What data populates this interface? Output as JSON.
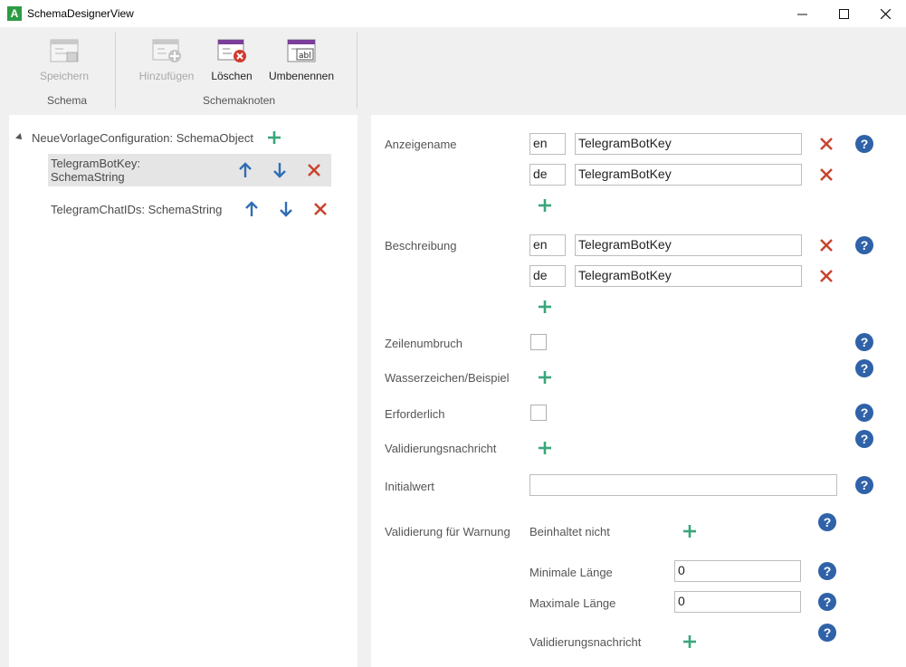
{
  "window": {
    "title": "SchemaDesignerView",
    "app_icon_letter": "A",
    "controls": [
      "minimize-icon",
      "maximize-icon",
      "close-icon"
    ]
  },
  "ribbon": {
    "groups": [
      {
        "label": "Schema",
        "buttons": [
          {
            "label": "Speichern",
            "enabled": false,
            "icon": "save-schema-icon"
          }
        ]
      },
      {
        "label": "Schemaknoten",
        "buttons": [
          {
            "label": "Hinzufügen",
            "enabled": false,
            "icon": "add-node-icon"
          },
          {
            "label": "Löschen",
            "enabled": true,
            "icon": "delete-node-icon"
          },
          {
            "label": "Umbenennen",
            "enabled": true,
            "icon": "rename-node-icon"
          }
        ]
      }
    ]
  },
  "tree": {
    "root": {
      "label": "NeueVorlageConfiguration: SchemaObject"
    },
    "items": [
      {
        "label": "TelegramBotKey: SchemaString",
        "selected": true
      },
      {
        "label": "TelegramChatIDs: SchemaString",
        "selected": false
      }
    ]
  },
  "properties": {
    "anzeigename": {
      "label": "Anzeigename",
      "entries": [
        {
          "lang": "en",
          "value": "TelegramBotKey"
        },
        {
          "lang": "de",
          "value": "TelegramBotKey"
        }
      ]
    },
    "beschreibung": {
      "label": "Beschreibung",
      "entries": [
        {
          "lang": "en",
          "value": "TelegramBotKey"
        },
        {
          "lang": "de",
          "value": "TelegramBotKey"
        }
      ]
    },
    "zeilenumbruch": {
      "label": "Zeilenumbruch",
      "checked": false
    },
    "wasserzeichen": {
      "label": "Wasserzeichen/Beispiel"
    },
    "erforderlich": {
      "label": "Erforderlich",
      "checked": false
    },
    "validierungsnachricht": {
      "label": "Validierungsnachricht"
    },
    "initialwert": {
      "label": "Initialwert",
      "value": ""
    },
    "warnung": {
      "label": "Validierung für Warnung",
      "beinhaltet_nicht": "Beinhaltet nicht",
      "min_label": "Minimale Länge",
      "min_value": "0",
      "max_label": "Maximale Länge",
      "max_value": "0",
      "nachricht_label": "Validierungsnachricht"
    }
  },
  "colors": {
    "add_green": "#3aa67a",
    "delete_red": "#c8452f",
    "arrow_blue": "#2f6eb5",
    "help_blue": "#2f62a8",
    "ribbon_purple": "#7b3f9a",
    "app_green": "#2e9b44"
  }
}
